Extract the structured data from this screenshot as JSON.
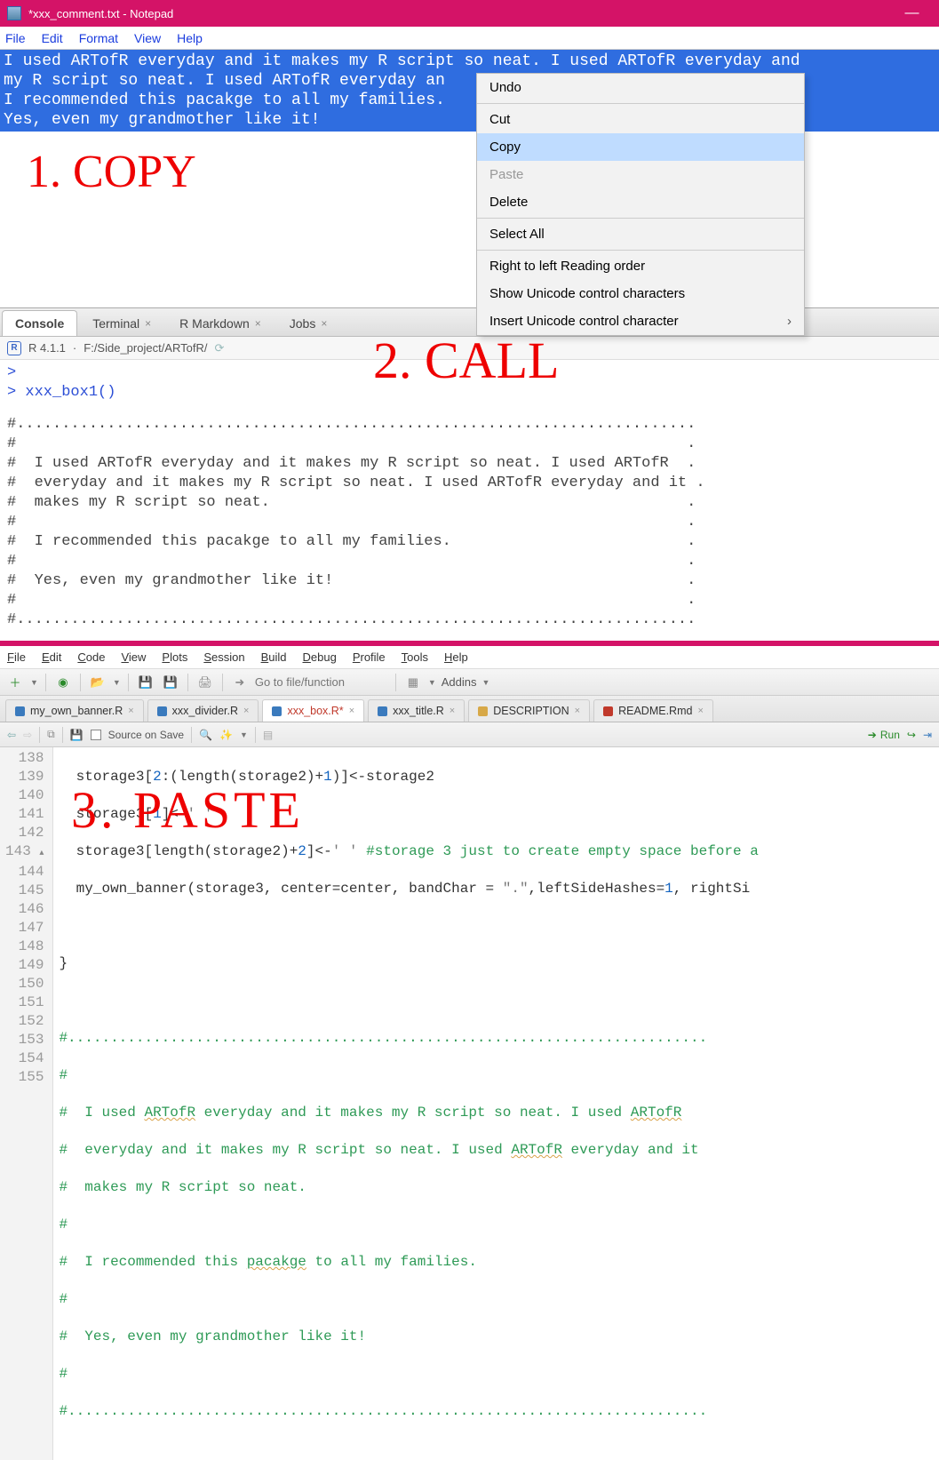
{
  "notepad": {
    "title": "*xxx_comment.txt - Notepad",
    "menus": {
      "file": "File",
      "edit": "Edit",
      "format": "Format",
      "view": "View",
      "help": "Help"
    },
    "text_line1": "I used ARTofR everyday and it makes my R script so neat. I used ARTofR everyday and",
    "text_line2": "my R script so neat. I used ARTofR everyday an",
    "text_line3": "I recommended this pacakge to all my families.",
    "text_line4": "Yes, even my grandmother like it!"
  },
  "context": {
    "undo": "Undo",
    "cut": "Cut",
    "copy": "Copy",
    "paste": "Paste",
    "delete": "Delete",
    "selectall": "Select All",
    "rtl": "Right to left Reading order",
    "showuni": "Show Unicode control characters",
    "insuni": "Insert Unicode control character"
  },
  "annotations": {
    "a1": "1. COPY",
    "a2": "2. CALL",
    "a3": "3. PASTE"
  },
  "console": {
    "tabs": {
      "console": "Console",
      "terminal": "Terminal",
      "rmd": "R Markdown",
      "jobs": "Jobs"
    },
    "rver": "R 4.1.1",
    "path": "F:/Side_project/ARTofR/",
    "prompt": ">",
    "call": "xxx_box1()",
    "out1": "#...........................................................................",
    "out2": "#                                                                          .",
    "out3": "#  I used ARTofR everyday and it makes my R script so neat. I used ARTofR  .",
    "out4": "#  everyday and it makes my R script so neat. I used ARTofR everyday and it .",
    "out5": "#  makes my R script so neat.                                              .",
    "out6": "#                                                                          .",
    "out7": "#  I recommended this pacakge to all my families.                          .",
    "out8": "#                                                                          .",
    "out9": "#  Yes, even my grandmother like it!                                       .",
    "out10": "#                                                                          .",
    "out11": "#..........................................................................."
  },
  "rstudio": {
    "menus": {
      "file": "File",
      "edit": "Edit",
      "code": "Code",
      "view": "View",
      "plots": "Plots",
      "session": "Session",
      "build": "Build",
      "debug": "Debug",
      "profile": "Profile",
      "tools": "Tools",
      "help": "Help"
    },
    "gotoPlaceholder": "Go to file/function",
    "addins": "Addins",
    "filetabs": {
      "t1": "my_own_banner.R",
      "t2": "xxx_divider.R",
      "t3": "xxx_box.R*",
      "t4": "xxx_title.R",
      "t5": "DESCRIPTION",
      "t6": "README.Rmd"
    },
    "sourceOnSave": "Source on Save",
    "run": "Run",
    "lines": {
      "n138": "138",
      "n139": "139",
      "n140": "140",
      "n141": "141",
      "n142": "142",
      "n143": "143",
      "n144": "144",
      "n145": "145",
      "n146": "146",
      "n147": "147",
      "n148": "148",
      "n149": "149",
      "n150": "150",
      "n151": "151",
      "n152": "152",
      "n153": "153",
      "n154": "154",
      "n155": "155"
    },
    "code": {
      "l138a": "storage3[",
      "l138b": "2",
      "l138c": ":(length(storage2)+",
      "l138d": "1",
      "l138e": ")]<-storage2",
      "l139a": "storage3[",
      "l139b": "1",
      "l139c": "]<-",
      "l139d": "' '",
      "l140a": "storage3[length(storage2)+",
      "l140b": "2",
      "l140c": "]<-",
      "l140d": "' '",
      "l140e": "#storage 3 just to create empty space before a",
      "l141a": "my_own_banner(storage3, center=center, bandChar = ",
      "l141b": "\".\"",
      "l141c": ",leftSideHashes=",
      "l141d": "1",
      "l141e": ", rightSi",
      "l143": "}",
      "l145": "#...........................................................................",
      "l146": "#                                                                           ",
      "l147a": "#  I used ",
      "l147b": "ARTofR",
      "l147c": " everyday and it makes my R script so neat. I used ",
      "l147d": "ARTofR",
      "l148a": "#  everyday and it makes my R script so neat. I used ",
      "l148b": "ARTofR",
      "l148c": " everyday and it",
      "l149": "#  makes my R script so neat.",
      "l150": "#                                                                           ",
      "l151a": "#  I recommended this ",
      "l151b": "pacakge",
      "l151c": " to all my families.",
      "l152": "#                                                                           ",
      "l153": "#  Yes, even my grandmother like it!",
      "l154": "#                                                                           ",
      "l155": "#..........................................................................."
    }
  }
}
